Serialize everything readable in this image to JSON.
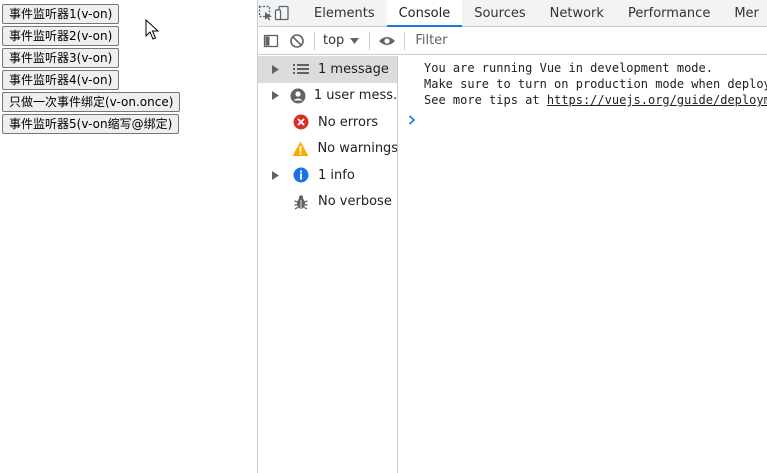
{
  "page": {
    "buttons": [
      "事件监听器1(v-on)",
      "事件监听器2(v-on)",
      "事件监听器3(v-on)",
      "事件监听器4(v-on)",
      "只做一次事件绑定(v-on.once)",
      "事件监听器5(v-on缩写@绑定)"
    ]
  },
  "devtools": {
    "tabs": [
      "Elements",
      "Console",
      "Sources",
      "Network",
      "Performance",
      "Mer"
    ],
    "active_tab": "Console",
    "toolbar": {
      "context": "top",
      "filter_placeholder": "Filter"
    },
    "sidebar": [
      {
        "label": "1 message",
        "icon": "list-icon",
        "expandable": true,
        "selected": true
      },
      {
        "label": "1 user mess…",
        "icon": "user-icon",
        "expandable": true,
        "selected": false
      },
      {
        "label": "No errors",
        "icon": "error-icon",
        "expandable": false,
        "selected": false
      },
      {
        "label": "No warnings",
        "icon": "warning-icon",
        "expandable": false,
        "selected": false
      },
      {
        "label": "1 info",
        "icon": "info-icon",
        "expandable": true,
        "selected": false
      },
      {
        "label": "No verbose",
        "icon": "bug-icon",
        "expandable": false,
        "selected": false
      }
    ],
    "console": {
      "line1": "You are running Vue in development mode.",
      "line2": "Make sure to turn on production mode when deploy",
      "line3_prefix": "See more tips at ",
      "line3_link": "https://vuejs.org/guide/deploym"
    },
    "colors": {
      "accent": "#1a73e8",
      "error": "#d93025",
      "warning": "#f9ab00",
      "info": "#1a73e8"
    }
  }
}
